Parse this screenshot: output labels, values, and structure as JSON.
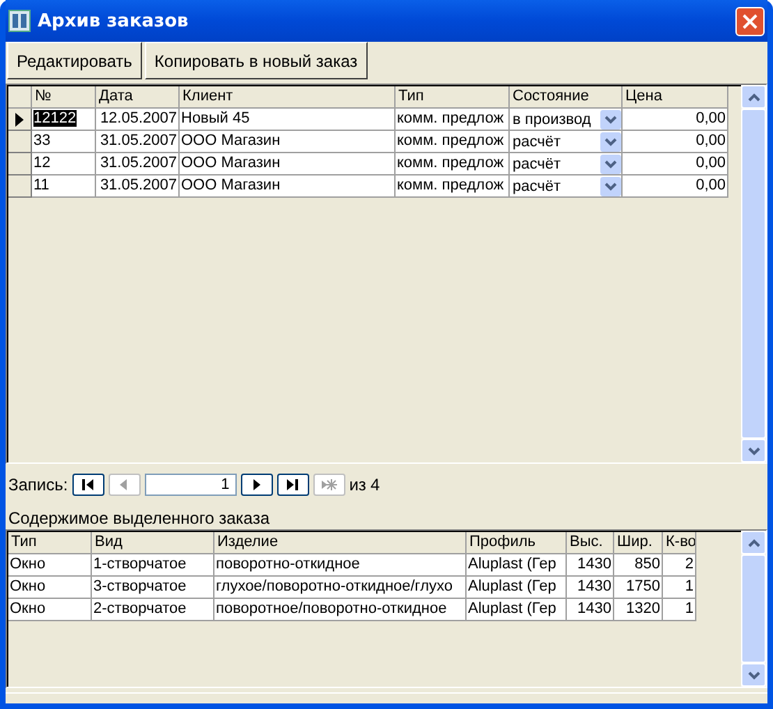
{
  "window": {
    "title": "Архив заказов"
  },
  "toolbar": [
    "Редактировать",
    "Копировать в новый заказ"
  ],
  "orders": {
    "columns": [
      "№",
      "Дата",
      "Клиент",
      "Тип",
      "Состояние",
      "Цена"
    ],
    "rows": [
      {
        "selected": true,
        "cells": [
          "12122",
          "12.05.2007",
          "Новый 45",
          "комм. предлож",
          "в производ",
          "0,00"
        ]
      },
      {
        "selected": false,
        "cells": [
          "33",
          "31.05.2007",
          "ООО Магазин",
          "комм. предлож",
          "расчёт",
          "0,00"
        ]
      },
      {
        "selected": false,
        "cells": [
          "12",
          "31.05.2007",
          "ООО Магазин",
          "комм. предлож",
          "расчёт",
          "0,00"
        ]
      },
      {
        "selected": false,
        "cells": [
          "11",
          "31.05.2007",
          "ООО Магазин",
          "комм. предлож",
          "расчёт",
          "0,00"
        ]
      }
    ]
  },
  "navigator": {
    "label": "Запись:",
    "current": "1",
    "of": "из",
    "total": "4",
    "buttons": [
      {
        "kind": "first",
        "disabled": false
      },
      {
        "kind": "prev",
        "disabled": true
      },
      {
        "kind": "next",
        "disabled": false
      },
      {
        "kind": "last",
        "disabled": false
      },
      {
        "kind": "new",
        "disabled": true
      }
    ]
  },
  "details": {
    "title": "Содержимое выделенного заказа",
    "columns": [
      "Тип",
      "Вид",
      "Изделие",
      "Профиль",
      "Выс.",
      "Шир.",
      "К-во"
    ],
    "rows": [
      [
        "Окно",
        "1-створчатое",
        "поворотно-откидное",
        "Aluplast (Гер",
        "1430",
        "850",
        "2"
      ],
      [
        "Окно",
        "3-створчатое",
        "глухое/поворотно-откидное/глухо",
        "Aluplast (Гер",
        "1430",
        "1750",
        "1"
      ],
      [
        "Окно",
        "2-створчатое",
        "поворотное/поворотно-откидное",
        "Aluplast (Гер",
        "1430",
        "1320",
        "1"
      ]
    ]
  }
}
